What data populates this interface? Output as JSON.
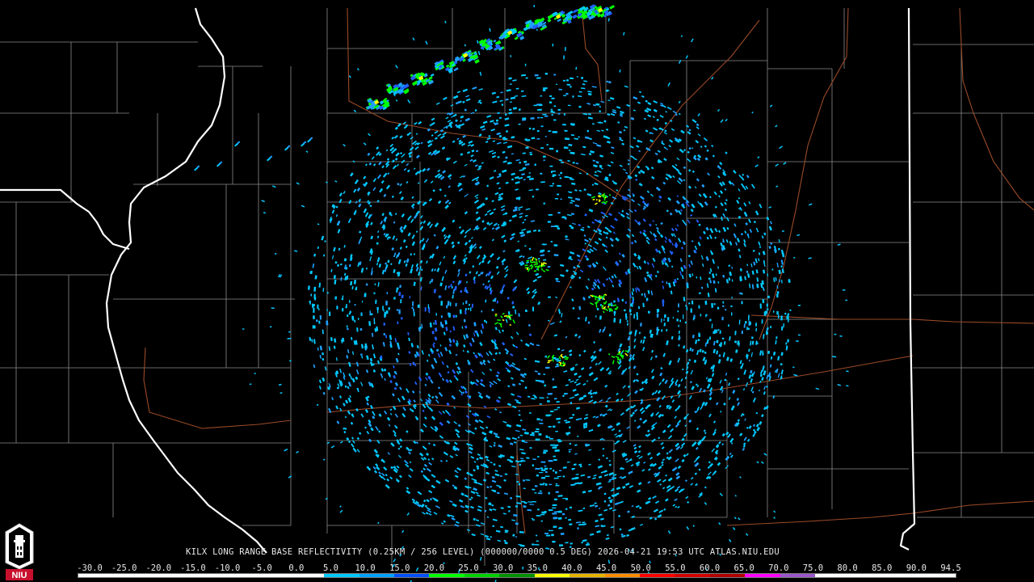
{
  "product": {
    "title": "KILX LONG RANGE BASE REFLECTIVITY (0.25KM / 256 LEVEL) (000000/0000 0.5 DEG) 2026-04-21 19:53 UTC  ATLAS.NIU.EDU"
  },
  "logo": {
    "text": "NIU",
    "icon": "university-tower-icon",
    "color": "#c8102e"
  },
  "color_scale": {
    "labels": [
      "-30.0",
      "-25.0",
      "-20.0",
      "-15.0",
      "-10.0",
      "-5.0",
      "0.0",
      "5.0",
      "10.0",
      "15.0",
      "20.0",
      "25.0",
      "30.0",
      "35.0",
      "40.0",
      "45.0",
      "50.0",
      "55.0",
      "60.0",
      "65.0",
      "70.0",
      "75.0",
      "80.0",
      "85.0",
      "90.0",
      "94.5"
    ],
    "colors": [
      "#ffffff",
      "#ffffff",
      "#ffffff",
      "#ffffff",
      "#ffffff",
      "#ffffff",
      "#ffffff",
      "#00c8ff",
      "#00a0ff",
      "#0050ff",
      "#00ff00",
      "#00d000",
      "#009000",
      "#ffff00",
      "#e6b400",
      "#ff8c00",
      "#ff0000",
      "#d40000",
      "#b00000",
      "#ff00ff",
      "#9955c9",
      "#ffffff",
      "#ffffff",
      "#ffffff",
      "#ffffff"
    ]
  },
  "map": {
    "radar_site": "KILX",
    "background": "#000000",
    "county_line_color": "#8a8a8a",
    "state_line_color": "#ffffff",
    "road_color": "#9a4a28",
    "echo_colors": [
      "#00c8ff",
      "#1ea0ff",
      "#2060ff",
      "#00ff00",
      "#ffff00"
    ]
  }
}
